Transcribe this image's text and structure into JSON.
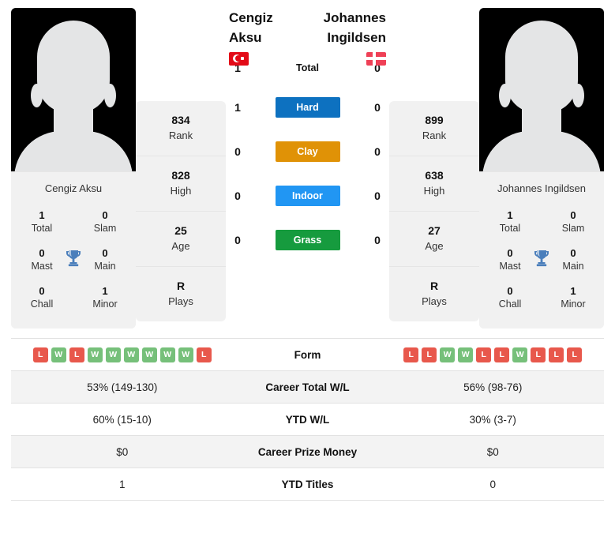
{
  "players": {
    "left": {
      "name": "Cengiz Aksu",
      "caption": "Cengiz Aksu",
      "flag": "turkey-flag",
      "titles": [
        {
          "value": "1",
          "label": "Total"
        },
        {
          "value": "0",
          "label": "Slam"
        },
        {
          "value": "0",
          "label": "Mast"
        },
        {
          "value": "0",
          "label": "Main"
        },
        {
          "value": "0",
          "label": "Chall"
        },
        {
          "value": "1",
          "label": "Minor"
        }
      ],
      "stats": [
        {
          "value": "834",
          "label": "Rank"
        },
        {
          "value": "828",
          "label": "High"
        },
        {
          "value": "25",
          "label": "Age"
        },
        {
          "value": "R",
          "label": "Plays"
        }
      ],
      "form": [
        "L",
        "W",
        "L",
        "W",
        "W",
        "W",
        "W",
        "W",
        "W",
        "L"
      ]
    },
    "right": {
      "name": "Johannes Ingildsen",
      "caption": "Johannes Ingildsen",
      "flag": "denmark-flag",
      "titles": [
        {
          "value": "1",
          "label": "Total"
        },
        {
          "value": "0",
          "label": "Slam"
        },
        {
          "value": "0",
          "label": "Mast"
        },
        {
          "value": "0",
          "label": "Main"
        },
        {
          "value": "0",
          "label": "Chall"
        },
        {
          "value": "1",
          "label": "Minor"
        }
      ],
      "stats": [
        {
          "value": "899",
          "label": "Rank"
        },
        {
          "value": "638",
          "label": "High"
        },
        {
          "value": "27",
          "label": "Age"
        },
        {
          "value": "R",
          "label": "Plays"
        }
      ],
      "form": [
        "L",
        "L",
        "W",
        "W",
        "L",
        "L",
        "W",
        "L",
        "L",
        "L"
      ]
    }
  },
  "head_to_head": [
    {
      "label": "Total",
      "left": "1",
      "right": "0",
      "color": null
    },
    {
      "label": "Hard",
      "left": "1",
      "right": "0",
      "color": "#0d71c0"
    },
    {
      "label": "Clay",
      "left": "0",
      "right": "0",
      "color": "#e09206"
    },
    {
      "label": "Indoor",
      "left": "0",
      "right": "0",
      "color": "#2196f3"
    },
    {
      "label": "Grass",
      "left": "0",
      "right": "0",
      "color": "#169b3e"
    }
  ],
  "comparison_table": {
    "rows": [
      {
        "label": "Form",
        "type": "form",
        "left": "",
        "right": ""
      },
      {
        "label": "Career Total W/L",
        "type": "text",
        "left": "53% (149-130)",
        "right": "56% (98-76)"
      },
      {
        "label": "YTD W/L",
        "type": "text",
        "left": "60% (15-10)",
        "right": "30% (3-7)"
      },
      {
        "label": "Career Prize Money",
        "type": "text",
        "left": "$0",
        "right": "$0"
      },
      {
        "label": "YTD Titles",
        "type": "text",
        "left": "1",
        "right": "0"
      }
    ]
  },
  "colors": {
    "win": "#76c07a",
    "loss": "#e8584c",
    "trophy": "#4a7ebb",
    "panel": "#f1f1f1"
  },
  "icons": {
    "trophy": "trophy-icon"
  }
}
